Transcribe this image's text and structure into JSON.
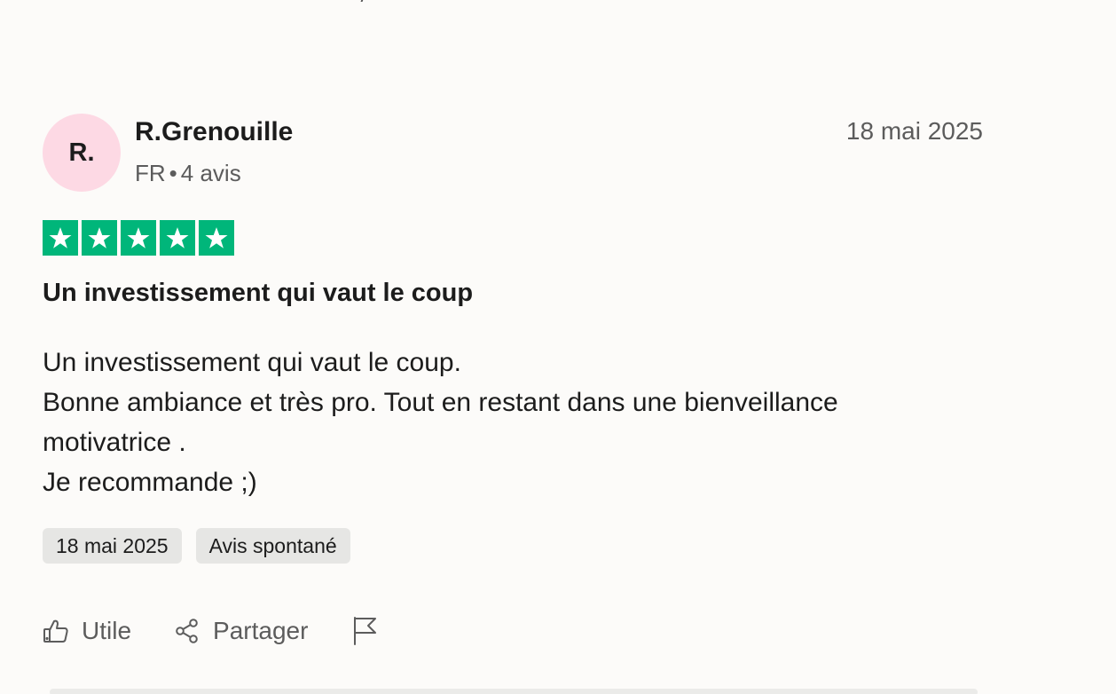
{
  "review": {
    "avatar_initials": "R.",
    "author_name": "R.Grenouille",
    "country": "FR",
    "separator": "•",
    "review_count": "4 avis",
    "date": "18 mai 2025",
    "rating": 5,
    "rating_color": "#00b67a",
    "title": "Un investissement qui vaut le coup",
    "body_lines": [
      "Un investissement qui vaut le coup.",
      "Bonne ambiance et très pro. Tout en restant dans une bienveillance",
      "motivatrice .",
      "Je recommande ;)"
    ],
    "chips": [
      "18 mai 2025",
      "Avis spontané"
    ],
    "actions": {
      "useful_label": "Utile",
      "useful_icon": "thumbs-up-icon",
      "share_label": "Partager",
      "share_icon": "share-icon",
      "report_icon": "flag-icon"
    }
  }
}
